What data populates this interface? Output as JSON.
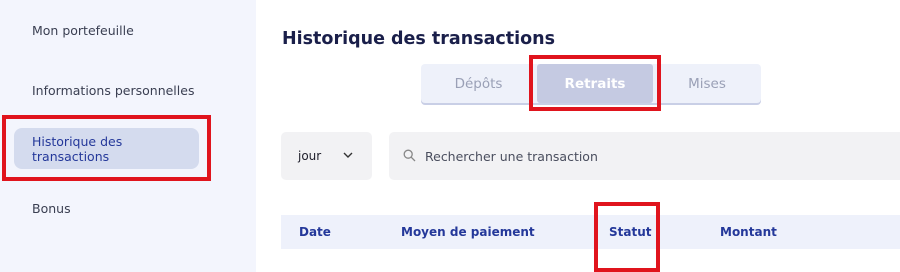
{
  "sidebar": {
    "items": [
      {
        "label": "Mon portefeuille"
      },
      {
        "label": "Informations personnelles"
      },
      {
        "label": "Historique des transactions"
      },
      {
        "label": "Bonus"
      }
    ]
  },
  "main": {
    "title": "Historique des transactions",
    "tabs": [
      {
        "label": "Dépôts"
      },
      {
        "label": "Retraits"
      },
      {
        "label": "Mises"
      }
    ],
    "period_select": {
      "value": "jour"
    },
    "search": {
      "placeholder": "Rechercher une transaction"
    },
    "table": {
      "columns": [
        "Date",
        "Moyen de paiement",
        "Statut",
        "Montant"
      ]
    }
  },
  "colors": {
    "accent": "#24389a",
    "highlight": "#e0141d",
    "sidebar_bg": "#f3f5fd",
    "active_tab_bg": "#c5cae2"
  },
  "icons": [
    "chevron-down-icon",
    "search-icon"
  ]
}
